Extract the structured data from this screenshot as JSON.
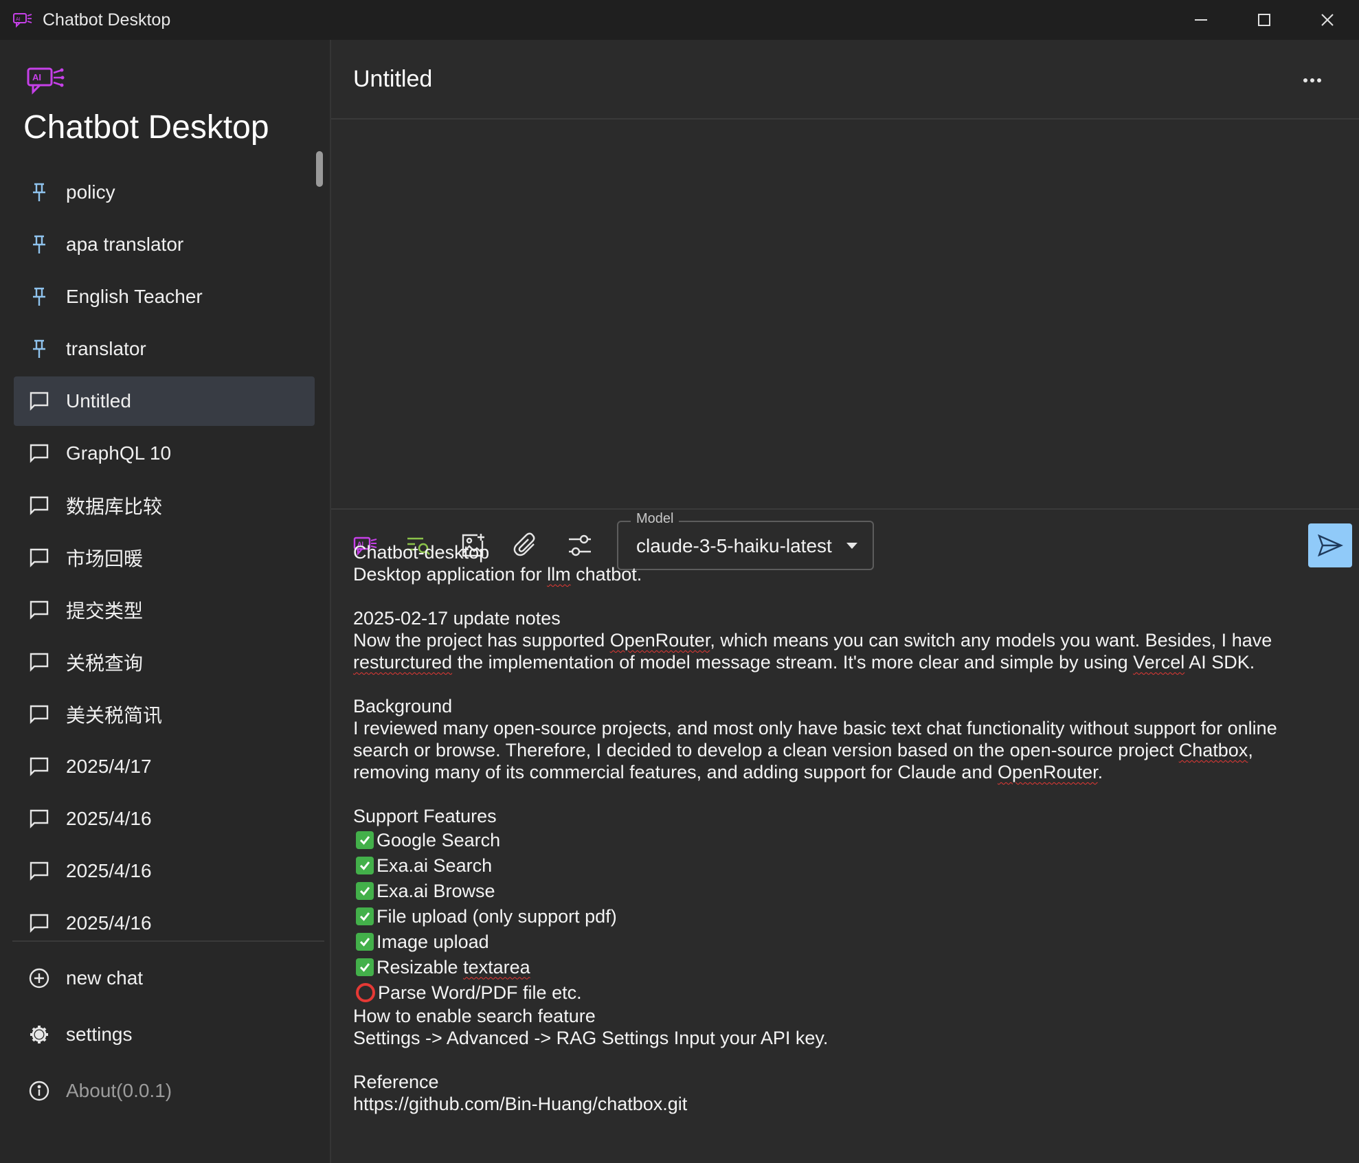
{
  "window": {
    "title": "Chatbot Desktop",
    "icon": "chatbot-ai-icon",
    "controls": [
      "minimize-icon",
      "maximize-icon",
      "close-icon"
    ]
  },
  "sidebar": {
    "brand_title": "Chatbot Desktop",
    "sessions": [
      {
        "label": "policy",
        "icon": "pin-icon",
        "pinned": true
      },
      {
        "label": "apa translator",
        "icon": "pin-icon",
        "pinned": true
      },
      {
        "label": "English Teacher",
        "icon": "pin-icon",
        "pinned": true
      },
      {
        "label": "translator",
        "icon": "pin-icon",
        "pinned": true
      },
      {
        "label": "Untitled",
        "icon": "chat-bubble-icon",
        "active": true
      },
      {
        "label": "GraphQL 10",
        "icon": "chat-bubble-icon"
      },
      {
        "label": "数据库比较",
        "icon": "chat-bubble-icon"
      },
      {
        "label": "市场回暖",
        "icon": "chat-bubble-icon"
      },
      {
        "label": "提交类型",
        "icon": "chat-bubble-icon"
      },
      {
        "label": "关税查询",
        "icon": "chat-bubble-icon"
      },
      {
        "label": "美关税简讯",
        "icon": "chat-bubble-icon"
      },
      {
        "label": "2025/4/17",
        "icon": "chat-bubble-icon"
      },
      {
        "label": "2025/4/16",
        "icon": "chat-bubble-icon"
      },
      {
        "label": "2025/4/16",
        "icon": "chat-bubble-icon"
      },
      {
        "label": "2025/4/16",
        "icon": "chat-bubble-icon"
      }
    ],
    "footer": {
      "new_chat": "new chat",
      "settings": "settings",
      "about": "About(0.0.1)"
    }
  },
  "main": {
    "conversation_title": "Untitled",
    "toolbar": {
      "tools": [
        "chatbot-ai-icon",
        "search-list-icon",
        "add-image-icon",
        "paperclip-icon",
        "settings-sliders-icon"
      ],
      "model_label": "Model",
      "model_value": "claude-3-5-haiku-latest"
    },
    "editor": {
      "line1": "Chatbot-desktop",
      "line2_pre": "Desktop application for ",
      "line2_sp": "llm",
      "line2_post": " chatbot.",
      "update_heading": "2025-02-17 update notes",
      "update_a": "Now the project has supported ",
      "update_b": "OpenRouter",
      "update_c": ", which means you can switch any models you want. Besides, I have",
      "update_d": "resturctured",
      "update_e": " the implementation of model message stream. It's more clear and simple by using ",
      "update_f": "Vercel",
      "update_g": " AI SDK.",
      "bg_heading": "Background",
      "bg_a": "I reviewed many open-source projects, and most only have basic text chat functionality without support for online",
      "bg_b": "search or browse. Therefore, I decided to develop a clean version based on the open-source project ",
      "bg_c": "Chatbox",
      "bg_d": ",",
      "bg_e": "removing many of its commercial features, and adding support for Claude and ",
      "bg_f": "OpenRouter",
      "bg_g": ".",
      "features_heading": "Support Features",
      "features": [
        {
          "text": "Google Search",
          "done": true
        },
        {
          "text": "Exa.ai Search",
          "done": true
        },
        {
          "text": "Exa.ai Browse",
          "done": true
        },
        {
          "text": "File upload (only support pdf)",
          "done": true
        },
        {
          "text": "Image upload",
          "done": true
        },
        {
          "text_pre": "Resizable ",
          "text_sp": "textarea",
          "done": true
        },
        {
          "text": "Parse Word/PDF file etc.",
          "done": false
        }
      ],
      "howto_heading": "How to enable search feature",
      "howto_text": "Settings -> Advanced -> RAG Settings Input your API key.",
      "ref_heading": "Reference",
      "ref_url": "https://github.com/Bin-Huang/chatbox.git"
    }
  },
  "colors": {
    "accent": "#90caf9",
    "brand_purple": "#c640e8",
    "check_green": "#43b04a",
    "todo_red": "#e53935"
  }
}
